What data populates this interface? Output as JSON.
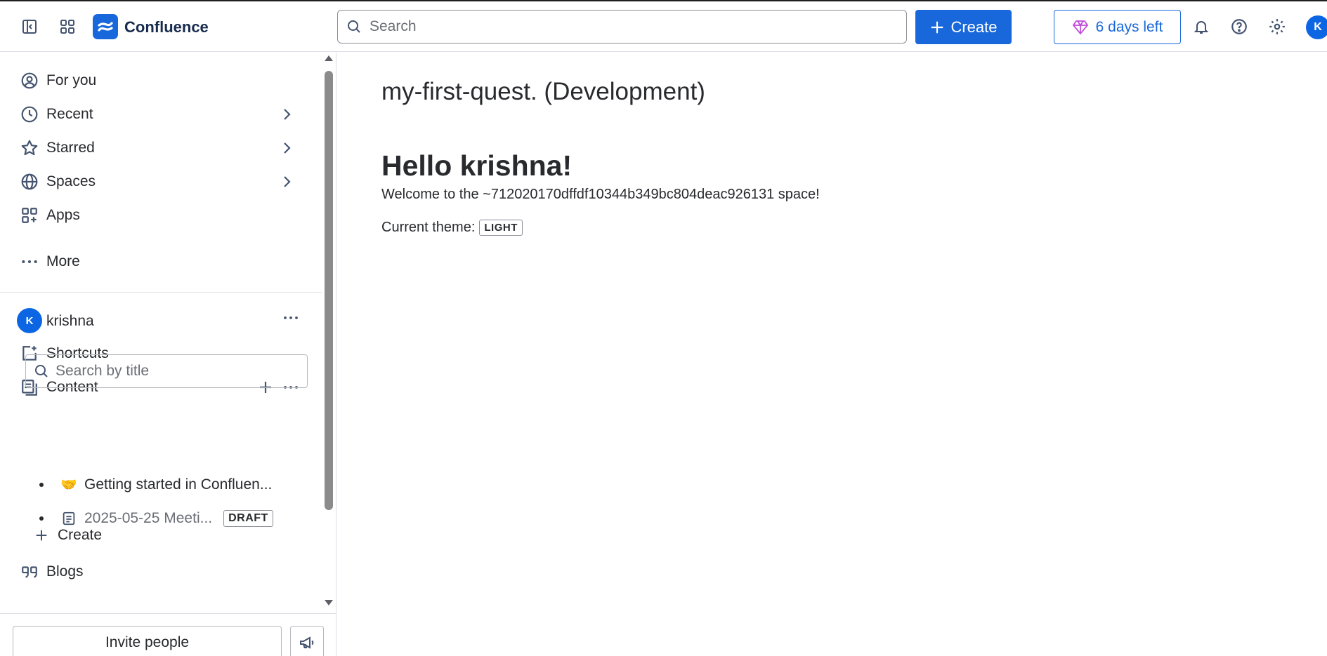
{
  "header": {
    "app_name": "Confluence",
    "search_placeholder": "Search",
    "create_label": "Create",
    "trial_label": "6 days left",
    "avatar_initial": "K",
    "accent_color": "#1868db",
    "icons": [
      "sidebar-toggle-icon",
      "app-switcher-icon",
      "confluence-logo-icon",
      "search-icon",
      "plus-icon",
      "gem-icon",
      "bell-icon",
      "help-icon",
      "gear-icon"
    ]
  },
  "sidebar": {
    "nav": [
      {
        "label": "For you",
        "icon": "person-circle-icon",
        "has_chevron": false
      },
      {
        "label": "Recent",
        "icon": "clock-icon",
        "has_chevron": true
      },
      {
        "label": "Starred",
        "icon": "star-icon",
        "has_chevron": true
      },
      {
        "label": "Spaces",
        "icon": "globe-icon",
        "has_chevron": true
      },
      {
        "label": "Apps",
        "icon": "apps-icon",
        "has_chevron": false
      },
      {
        "label": "More",
        "icon": "more-icon",
        "has_chevron": false
      }
    ],
    "space": {
      "avatar_initial": "K",
      "name": "krishna"
    },
    "shortcuts_label": "Shortcuts",
    "content_label": "Content",
    "title_search_placeholder": "Search by title",
    "tree": [
      {
        "emoji": "🤝",
        "label": "Getting started in Confluen..."
      },
      {
        "icon": "page-icon",
        "label": "2025-05-25 Meeti...",
        "badge": "DRAFT"
      }
    ],
    "create_label": "Create",
    "blogs_label": "Blogs",
    "invite_label": "Invite people"
  },
  "main": {
    "page_title": "my-first-quest. (Development)",
    "heading": "Hello krishna!",
    "welcome_text": "Welcome to the ~712020170dffdf10344b349bc804deac926131 space!",
    "theme_label": "Current theme:",
    "theme_value": "LIGHT"
  }
}
